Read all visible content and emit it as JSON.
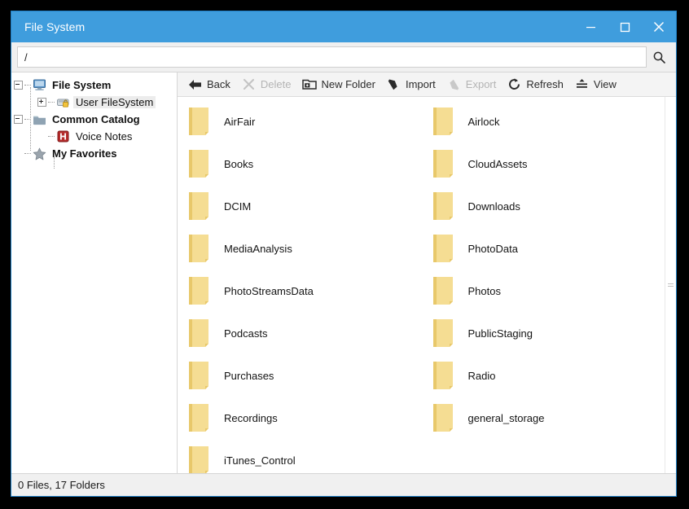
{
  "window": {
    "title": "File System",
    "titlebar_color": "#3f9ddd",
    "border_color": "#1f7fc4",
    "controls": [
      {
        "name": "minimize",
        "glyph": "–"
      },
      {
        "name": "maximize",
        "glyph": "☐"
      },
      {
        "name": "close",
        "glyph": "✕"
      }
    ]
  },
  "pathbar": {
    "value": "/",
    "placeholder": "/",
    "search_icon": "search-icon"
  },
  "sidebar": {
    "items": [
      {
        "label": "File System",
        "icon": "computer-icon",
        "bold": true,
        "level": 0,
        "expander": "minus",
        "selected": false
      },
      {
        "label": "User FileSystem",
        "icon": "locked-drive-icon",
        "bold": false,
        "level": 1,
        "expander": "plus",
        "selected": true
      },
      {
        "label": "Common Catalog",
        "icon": "folder-icon",
        "bold": true,
        "level": 0,
        "expander": "minus",
        "selected": false
      },
      {
        "label": "Voice Notes",
        "icon": "voice-notes-icon",
        "bold": false,
        "level": 1,
        "expander": "none",
        "selected": false
      },
      {
        "label": "My Favorites",
        "icon": "star-icon",
        "bold": true,
        "level": 0,
        "expander": "none",
        "selected": false
      }
    ]
  },
  "toolbar": {
    "items": [
      {
        "label": "Back",
        "icon": "back-arrow-icon",
        "disabled": false
      },
      {
        "label": "Delete",
        "icon": "x-cross-icon",
        "disabled": true
      },
      {
        "label": "New Folder",
        "icon": "new-folder-icon",
        "disabled": false
      },
      {
        "label": "Import",
        "icon": "import-arrow-icon",
        "disabled": false
      },
      {
        "label": "Export",
        "icon": "export-arrow-icon",
        "disabled": true
      },
      {
        "label": "Refresh",
        "icon": "refresh-icon",
        "disabled": false
      },
      {
        "label": "View",
        "icon": "view-icon",
        "disabled": false
      }
    ]
  },
  "files": {
    "folder_color": "#f5dd93",
    "folder_color_dark": "#e8c86a",
    "items": [
      {
        "name": "AirFair",
        "type": "folder"
      },
      {
        "name": "Airlock",
        "type": "folder"
      },
      {
        "name": "Books",
        "type": "folder"
      },
      {
        "name": "CloudAssets",
        "type": "folder"
      },
      {
        "name": "DCIM",
        "type": "folder"
      },
      {
        "name": "Downloads",
        "type": "folder"
      },
      {
        "name": "MediaAnalysis",
        "type": "folder"
      },
      {
        "name": "PhotoData",
        "type": "folder"
      },
      {
        "name": "PhotoStreamsData",
        "type": "folder"
      },
      {
        "name": "Photos",
        "type": "folder"
      },
      {
        "name": "Podcasts",
        "type": "folder"
      },
      {
        "name": "PublicStaging",
        "type": "folder"
      },
      {
        "name": "Purchases",
        "type": "folder"
      },
      {
        "name": "Radio",
        "type": "folder"
      },
      {
        "name": "Recordings",
        "type": "folder"
      },
      {
        "name": "general_storage",
        "type": "folder"
      },
      {
        "name": "iTunes_Control",
        "type": "folder"
      }
    ]
  },
  "statusbar": {
    "text": "0 Files, 17 Folders"
  }
}
